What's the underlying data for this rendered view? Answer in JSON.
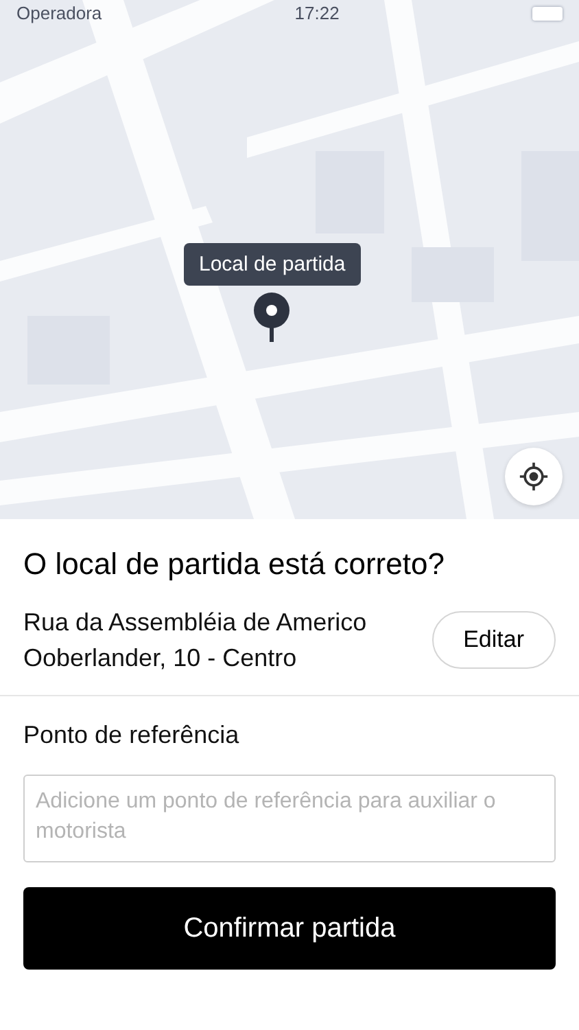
{
  "status_bar": {
    "carrier": "Operadora",
    "time": "17:22"
  },
  "map": {
    "pin_label": "Local de partida"
  },
  "sheet": {
    "question": "O local de partida está correto?",
    "address": "Rua da Assembléia de Americo Ooberlander, 10 - Centro",
    "edit_button": "Editar",
    "reference_label": "Ponto de referência",
    "reference_field": {
      "placeholder": "Adicione um ponto de referência para auxiliar o motorista"
    },
    "confirm_button": "Confirmar partida"
  }
}
